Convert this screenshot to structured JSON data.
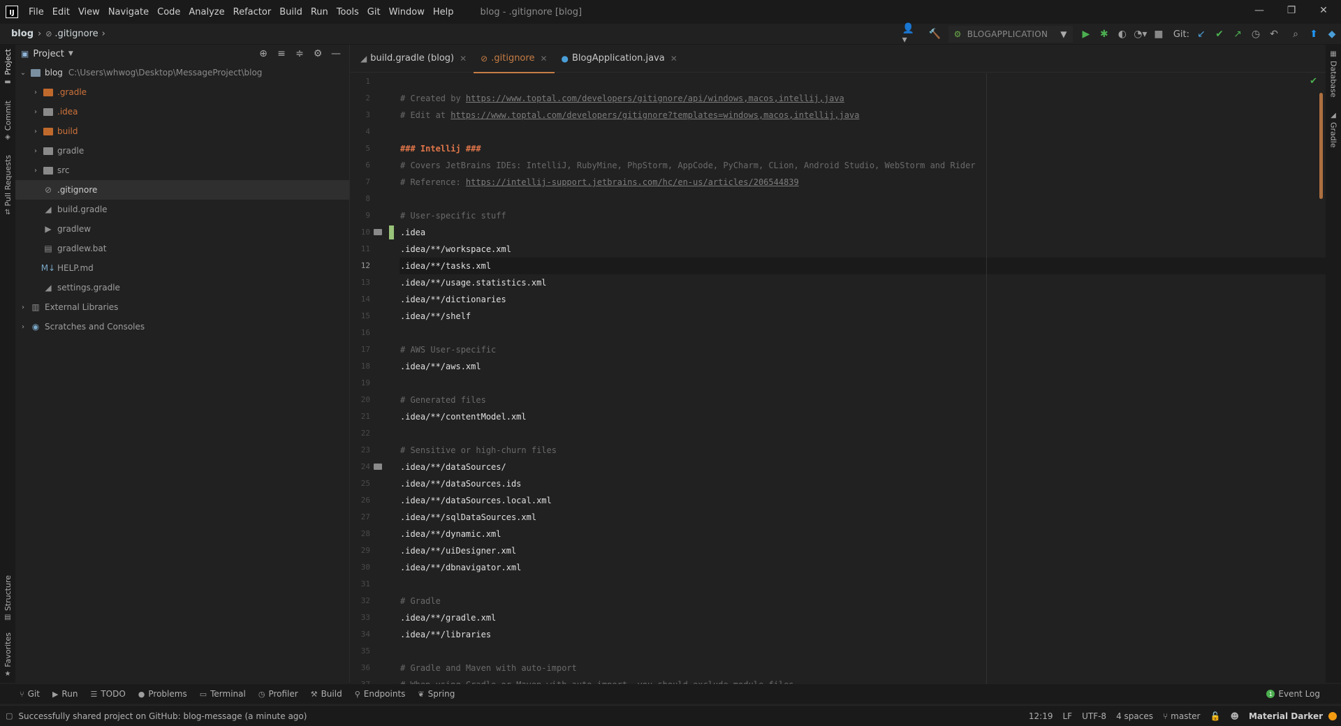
{
  "window": {
    "logo_text": "IJ",
    "title": "blog - .gitignore [blog]",
    "controls": {
      "minimize": "—",
      "restore": "❐",
      "close": "✕"
    }
  },
  "menu": [
    {
      "id": "file",
      "label": "File"
    },
    {
      "id": "edit",
      "label": "Edit"
    },
    {
      "id": "view",
      "label": "View"
    },
    {
      "id": "navigate",
      "label": "Navigate"
    },
    {
      "id": "code",
      "label": "Code"
    },
    {
      "id": "analyze",
      "label": "Analyze"
    },
    {
      "id": "refactor",
      "label": "Refactor"
    },
    {
      "id": "build",
      "label": "Build"
    },
    {
      "id": "run",
      "label": "Run"
    },
    {
      "id": "tools",
      "label": "Tools"
    },
    {
      "id": "git",
      "label": "Git"
    },
    {
      "id": "window",
      "label": "Window"
    },
    {
      "id": "help",
      "label": "Help"
    }
  ],
  "breadcrumb": {
    "project": "blog",
    "file": ".gitignore"
  },
  "toolbar": {
    "run_config": "BLOGAPPLICATION",
    "git_label": "Git:"
  },
  "left_tabs": {
    "project": "Project",
    "commit": "Commit",
    "pull_requests": "Pull Requests",
    "structure": "Structure",
    "favorites": "Favorites"
  },
  "right_tabs": {
    "database": "Database",
    "gradle": "Gradle"
  },
  "project_panel": {
    "title": "Project",
    "root": {
      "name": "blog",
      "path": "C:\\Users\\whwog\\Desktop\\MessageProject\\blog"
    },
    "items": [
      {
        "label": ".gradle",
        "kind": "folder-orange"
      },
      {
        "label": ".idea",
        "kind": "folder-gray"
      },
      {
        "label": "build",
        "kind": "folder-orange"
      },
      {
        "label": "gradle",
        "kind": "folder-gray"
      },
      {
        "label": "src",
        "kind": "folder-gray"
      },
      {
        "label": ".gitignore",
        "kind": "file"
      },
      {
        "label": "build.gradle",
        "kind": "file"
      },
      {
        "label": "gradlew",
        "kind": "file"
      },
      {
        "label": "gradlew.bat",
        "kind": "file"
      },
      {
        "label": "HELP.md",
        "kind": "file"
      },
      {
        "label": "settings.gradle",
        "kind": "file"
      },
      {
        "label": "External Libraries",
        "kind": "library"
      },
      {
        "label": "Scratches and Consoles",
        "kind": "scratch"
      }
    ]
  },
  "tabs": [
    {
      "label": "build.gradle (blog)",
      "icon": "gradle-icon"
    },
    {
      "label": ".gitignore",
      "icon": "gitignore-icon"
    },
    {
      "label": "BlogApplication.java",
      "icon": "java-class-icon"
    }
  ],
  "editor": {
    "current_line": 12,
    "lines": [
      [],
      [
        {
          "t": "c",
          "v": "# Created by "
        },
        {
          "t": "l",
          "v": "https://www.toptal.com/developers/gitignore/api/windows,macos,intellij,java"
        }
      ],
      [
        {
          "t": "c",
          "v": "# Edit at "
        },
        {
          "t": "l",
          "v": "https://www.toptal.com/developers/gitignore?templates=windows,macos,intellij,java"
        }
      ],
      [],
      [
        {
          "t": "h",
          "v": "### Intellij ###"
        }
      ],
      [
        {
          "t": "c",
          "v": "# Covers JetBrains IDEs: IntelliJ, RubyMine, PhpStorm, AppCode, PyCharm, CLion, Android Studio, WebStorm and Rider"
        }
      ],
      [
        {
          "t": "c",
          "v": "# Reference: "
        },
        {
          "t": "l",
          "v": "https://intellij-support.jetbrains.com/hc/en-us/articles/206544839"
        }
      ],
      [],
      [
        {
          "t": "c",
          "v": "# User-specific stuff"
        }
      ],
      [
        {
          "t": "p",
          "v": ".idea"
        }
      ],
      [
        {
          "t": "p",
          "v": ".idea/**/workspace.xml"
        }
      ],
      [
        {
          "t": "p",
          "v": ".idea/**/tasks.xml"
        }
      ],
      [
        {
          "t": "p",
          "v": ".idea/**/usage.statistics.xml"
        }
      ],
      [
        {
          "t": "p",
          "v": ".idea/**/dictionaries"
        }
      ],
      [
        {
          "t": "p",
          "v": ".idea/**/shelf"
        }
      ],
      [],
      [
        {
          "t": "c",
          "v": "# AWS User-specific"
        }
      ],
      [
        {
          "t": "p",
          "v": ".idea/**/aws.xml"
        }
      ],
      [],
      [
        {
          "t": "c",
          "v": "# Generated files"
        }
      ],
      [
        {
          "t": "p",
          "v": ".idea/**/contentModel.xml"
        }
      ],
      [],
      [
        {
          "t": "c",
          "v": "# Sensitive or high-churn files"
        }
      ],
      [
        {
          "t": "p",
          "v": ".idea/**/dataSources/"
        }
      ],
      [
        {
          "t": "p",
          "v": ".idea/**/dataSources.ids"
        }
      ],
      [
        {
          "t": "p",
          "v": ".idea/**/dataSources.local.xml"
        }
      ],
      [
        {
          "t": "p",
          "v": ".idea/**/sqlDataSources.xml"
        }
      ],
      [
        {
          "t": "p",
          "v": ".idea/**/dynamic.xml"
        }
      ],
      [
        {
          "t": "p",
          "v": ".idea/**/uiDesigner.xml"
        }
      ],
      [
        {
          "t": "p",
          "v": ".idea/**/dbnavigator.xml"
        }
      ],
      [],
      [
        {
          "t": "c",
          "v": "# Gradle"
        }
      ],
      [
        {
          "t": "p",
          "v": ".idea/**/gradle.xml"
        }
      ],
      [
        {
          "t": "p",
          "v": ".idea/**/libraries"
        }
      ],
      [],
      [
        {
          "t": "c",
          "v": "# Gradle and Maven with auto-import"
        }
      ],
      [
        {
          "t": "c",
          "v": "# When using Gradle or Maven with auto-import, you should exclude module files,"
        }
      ]
    ],
    "fold_lines": [
      10,
      24
    ],
    "changed_lines": [
      10
    ]
  },
  "tool_windows": [
    {
      "label": "Git",
      "icon": "git-branch-icon"
    },
    {
      "label": "Run",
      "icon": "run-icon"
    },
    {
      "label": "TODO",
      "icon": "todo-icon"
    },
    {
      "label": "Problems",
      "icon": "problems-icon"
    },
    {
      "label": "Terminal",
      "icon": "terminal-icon"
    },
    {
      "label": "Profiler",
      "icon": "profiler-icon"
    },
    {
      "label": "Build",
      "icon": "build-icon"
    },
    {
      "label": "Endpoints",
      "icon": "endpoints-icon"
    },
    {
      "label": "Spring",
      "icon": "spring-icon"
    }
  ],
  "event_log": "Event Log",
  "status": {
    "message": "Successfully shared project on GitHub: blog-message (a minute ago)",
    "position": "12:19",
    "line_separator": "LF",
    "encoding": "UTF-8",
    "indent": "4 spaces",
    "branch": "master",
    "theme": "Material Darker"
  },
  "colors": {
    "accent": "#c67d45",
    "background": "#212121",
    "comment": "#6a6a6a",
    "heading": "#e0764a",
    "folder_excluded": "#c0692d",
    "change_marker": "#98c379"
  }
}
